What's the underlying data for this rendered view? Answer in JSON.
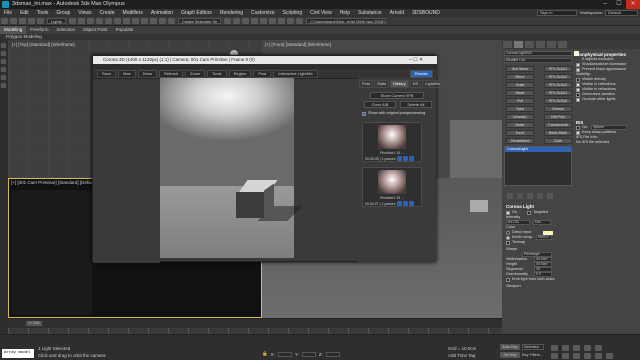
{
  "title": "3dsmax_ini.max - Autodesk 3ds Max Olympus",
  "menus": [
    "File",
    "Edit",
    "Tools",
    "Group",
    "Views",
    "Create",
    "Modifiers",
    "Animation",
    "Graph Editors",
    "Rendering",
    "Customize",
    "Scripting",
    "Civil View",
    "Help",
    "Substance",
    "Arnold",
    "3DSBOUND"
  ],
  "sign_in": "Sign In",
  "workspaces_label": "Workspaces:",
  "workspace_value": "Default",
  "path_value": "C:\\Users\\pauz\\Des...erial (26th Nov 2018)",
  "toolbar": {
    "selection_set": "Create Selection Se",
    "view_sel": "Lights"
  },
  "ribbon_tabs": [
    "Modeling",
    "Freeform",
    "Selection",
    "Object Paint",
    "Populate"
  ],
  "ribbon_sub": "Polygon Modeling",
  "viewports": {
    "top": "[+] [Top] [Standard] [Wireframe]",
    "front": "[+] [Front] [Standard] [Wireframe]",
    "camera": "[+] [001 Cam Primitive] [Standard] [Default Shading]"
  },
  "vfb": {
    "title": "Corona 3D (1400 x 1120px) (1:1) | Camera: 001 Cam Primitive | Frame 0 (0)",
    "buttons": [
      "Save",
      "Max",
      "Dens",
      "Refresh",
      "Zoom",
      "Tools",
      "Region",
      "Post",
      "Interactive LightMix"
    ],
    "render_btn": "Render",
    "tabs": [
      "Post",
      "Stats",
      "History",
      "DR",
      "LightMix"
    ],
    "active_tab": "History",
    "store_btn": "Store Current VFB",
    "clear_ab": "Clear A/B",
    "delete_all": "Delete All",
    "show_original": "Show with original postprocessing",
    "history": [
      {
        "label": "Primitive1 15 ...",
        "time": "00:05:28 | 1 passes"
      },
      {
        "label": "Primitive1 15 ...",
        "time": "00:04:27 | 1 passes"
      }
    ]
  },
  "command_panel": {
    "object_name": "Corona Light002",
    "modifier_list": "Modifier List",
    "buttons": [
      [
        "Sun Moon",
        "PFX ScOv1"
      ],
      [
        "Mirror",
        "PFX ScOv2"
      ],
      [
        "Scale",
        "PFX ScOv3"
      ],
      [
        "Wave",
        "PFX ScOv1"
      ],
      [
        "Pull",
        "PFX ScOv5"
      ],
      [
        "Twist",
        "Normal"
      ],
      [
        "Unwrap1",
        "Edit Poly"
      ],
      [
        "Noise",
        "Turbosmooth"
      ],
      [
        "Turn1",
        "Relax Mesh"
      ],
      [
        "TerrainBend",
        "Cloth"
      ]
    ],
    "stack_item": "CoronaLight",
    "nonphys_title": "Nonphysical properties",
    "nonphys_checks": [
      {
        "label": "Shadowcatcher illuminator",
        "on": true
      },
      {
        "label": "Prevent black appearance",
        "on": true
      },
      {
        "label": "Visible directly",
        "on": false
      },
      {
        "label": "Visible in reflections",
        "on": true
      },
      {
        "label": "Visible in refractions",
        "on": true
      },
      {
        "label": "Generated caustics",
        "on": false
      },
      {
        "label": "Occlude other lights",
        "on": true
      }
    ],
    "visibility_label": "Visibility:",
    "affects_label": "0 objects excluded",
    "ies_title": "IES",
    "ies_on": "On",
    "ies_file": "Sphere",
    "ies_sharp": "Keep sharp patterns",
    "ies_info1": "IES File Info:",
    "ies_info2": "No IES file selected.",
    "light_title": "Corona Light",
    "on_label": "On",
    "targeted_label": "Targeted",
    "intensity_label": "Intensity",
    "intensity_value": "64.133",
    "intensity_unit": "Def...",
    "color_label": "Color",
    "color_direct": "Direct input",
    "color_kelvin": "Kelvin temp.",
    "kelvin_value": "6500.0",
    "texmap_label": "Texmap",
    "shape_label": "Shape",
    "shape_value": "Rectangle",
    "width_label": "Width/radius",
    "width_value": "40.0cm",
    "height_label": "Height",
    "height_value": "40.0cm",
    "segments_label": "Segments",
    "segments_value": "16",
    "directional_label": "Directionality",
    "directional_value": "0.0",
    "emit_label": "Emit light from both sides",
    "viewport_label": "Viewport"
  },
  "timeline": {
    "frame": "0 / 100"
  },
  "status": {
    "selected": "1 Light Selected",
    "hint": "Click and drag to orbit the camera",
    "script": "Array modеl",
    "x_label": "X:",
    "y_label": "Y:",
    "z_label": "Z:",
    "grid": "Grid = 10.0cm",
    "add_time_tag": "Add Time Tag",
    "autokey": "Auto Key",
    "selected_btn": "Selected",
    "setkey": "Set Key",
    "key_filters": "Key Filters..."
  },
  "accent": "#2e63b3",
  "active_border": "#d9b84a"
}
